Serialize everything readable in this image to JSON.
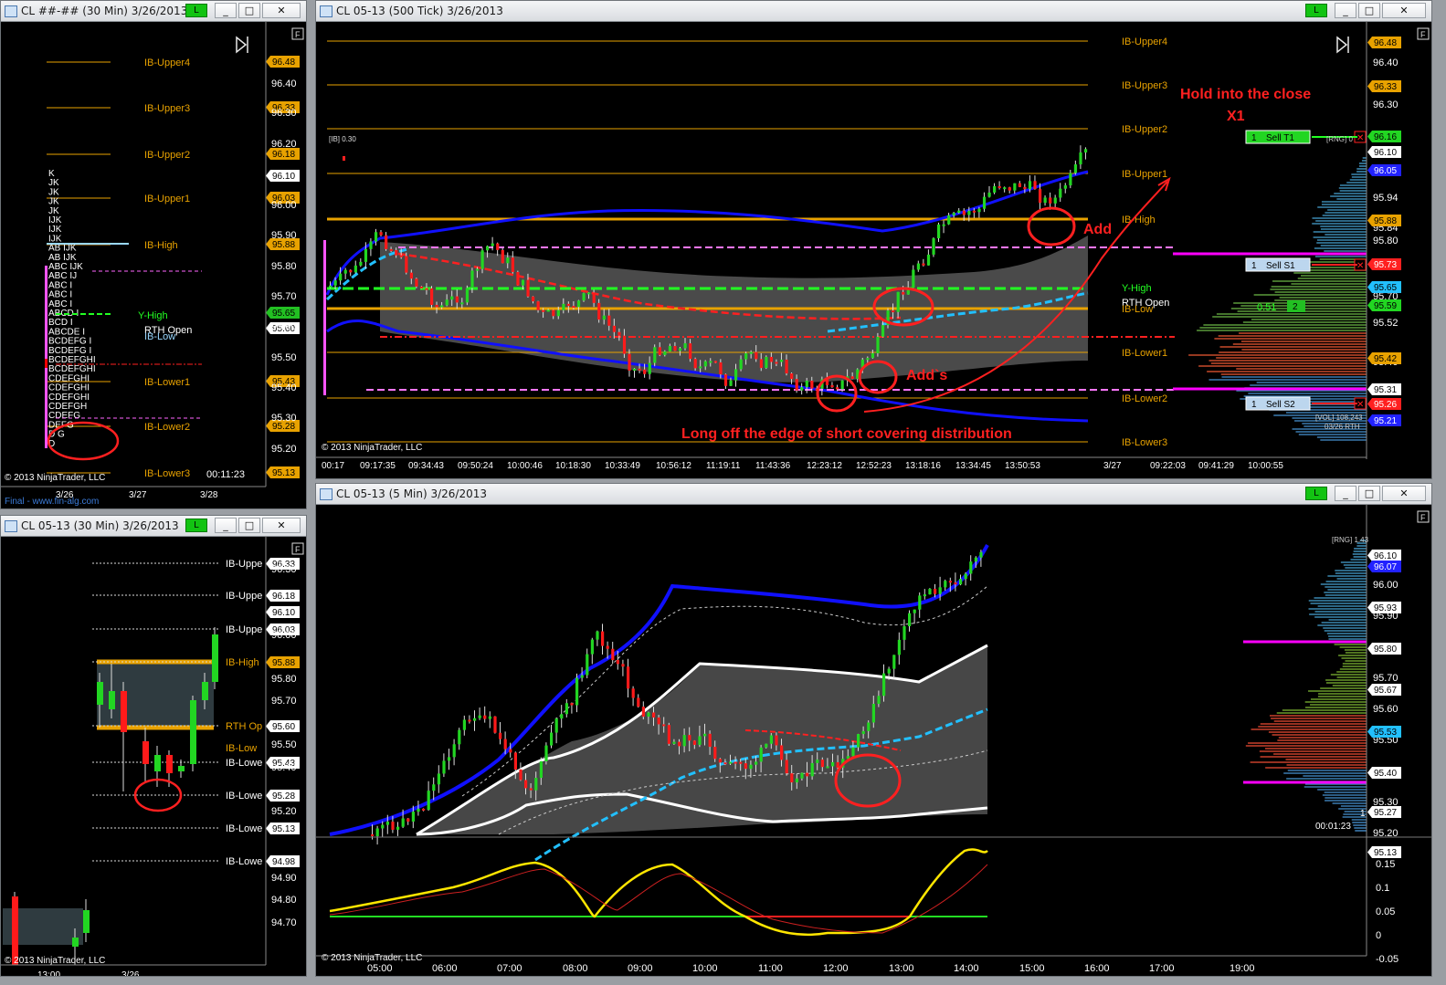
{
  "windows": {
    "tpo": {
      "title": "CL ##-## (30 Min)  3/26/2013",
      "btn_l": "L"
    },
    "tick": {
      "title": "CL 05-13 (500 Tick)  3/26/2013",
      "btn_l": "L"
    },
    "min30": {
      "title": "CL 05-13 (30 Min)  3/26/2013",
      "btn_l": "L"
    },
    "min5": {
      "title": "CL 05-13 (5 Min)  3/26/2013",
      "btn_l": "L"
    }
  },
  "window_buttons": {
    "minimize": "_",
    "maximize": "□",
    "close": "✕"
  },
  "common": {
    "copyright": "© 2013 NinjaTrader, LLC",
    "f_box": "F"
  },
  "colors": {
    "bg": "#000000",
    "up_bar": "#22d622",
    "down_bar": "#ff1a1a",
    "ib_lines": "#e8a200",
    "keltner": "#1010ff",
    "profile": "#2fa0c0",
    "annotation": "#ff2020"
  },
  "tpo": {
    "levels": [
      {
        "name": "IB-Upper4",
        "price": "96.48"
      },
      {
        "name": "IB-Upper3",
        "price": "96.33"
      },
      {
        "name": "IB-Upper2",
        "price": "96.18"
      },
      {
        "name": "IB-Upper1",
        "price": "96.03"
      },
      {
        "name": "IB-High",
        "price": "95.88"
      },
      {
        "name": "IB-Lower1",
        "price": "95.43"
      },
      {
        "name": "IB-Lower2",
        "price": "95.28"
      },
      {
        "name": "IB-Lower3",
        "price": "95.13"
      }
    ],
    "misc_labels": {
      "y_high": "Y-High",
      "y_high_price": "95.65",
      "rth_open": "RTH Open",
      "rth_price": "95.60",
      "ib_low": "IB-Low"
    },
    "axis": [
      "96.40",
      "96.30",
      "96.20",
      "96.10",
      "96.00",
      "95.90",
      "95.80",
      "95.70",
      "95.60",
      "95.50",
      "95.40",
      "95.30",
      "95.20"
    ],
    "tpo_rows": [
      "K",
      "JK",
      "JK",
      "JK",
      "JK",
      "IJK",
      "IJK",
      "IJK",
      "AB      IJK",
      "AB      IJK",
      "ABC     IJK",
      "ABC     IJ",
      "ABC     I",
      "ABC     I",
      "ABC     I",
      "ABCD    I",
      "BCD     I",
      "ABCDE   I",
      "BCDEFG  I",
      "BCDEFG  I",
      "BCDEFGHI",
      "BCDEFGHI",
      "CDEFGHI",
      "CDEFGHI",
      "CDEFGHI",
      "CDEFGH",
      "CDEFG",
      "DEFG",
      "D   G",
      "D"
    ],
    "x_axis": [
      "3/26",
      "3/27",
      "3/28"
    ],
    "timer": "00:11:23",
    "footer": "Final - www.fin-alg.com"
  },
  "tick": {
    "levels": [
      {
        "name": "IB-Upper4"
      },
      {
        "name": "IB-Upper3"
      },
      {
        "name": "IB-Upper2"
      },
      {
        "name": "IB-Upper1"
      },
      {
        "name": "IB-High"
      },
      {
        "name": "Y-High"
      },
      {
        "name": "RTH Open"
      },
      {
        "name": "IB-Low"
      },
      {
        "name": "IB-Lower1"
      },
      {
        "name": "IB-Lower2"
      },
      {
        "name": "IB-Lower3"
      }
    ],
    "price_tags": [
      "96.48",
      "96.33",
      "96.16",
      "96.05",
      "95.88",
      "95.73",
      "95.65",
      "95.59",
      "95.42",
      "95.31",
      "95.26",
      "95.21"
    ],
    "axis": [
      "96.40",
      "96.30",
      "96.10",
      "95.94",
      "95.84",
      "95.80",
      "95.70",
      "95.52",
      "95.40"
    ],
    "ib_label": "[IB] 0.30",
    "orders": [
      {
        "qty": "1",
        "label": "Sell T1"
      },
      {
        "qty": "1",
        "label": "Sell S1"
      },
      {
        "qty": "1",
        "label": "Sell S2"
      }
    ],
    "rng_label": "[RNG] 0",
    "vol_label": "[VOL] 108,243",
    "vol_date": "03/26 RTH",
    "mid_value": "0.51",
    "mid_qty": "2",
    "time_axis": [
      "00:17",
      "09:17:35",
      "09:34:43",
      "09:50:24",
      "10:00:46",
      "10:18:30",
      "10:33:49",
      "10:56:12",
      "11:19:11",
      "11:43:36",
      "12:23:12",
      "12:52:23",
      "13:18:16",
      "13:34:45",
      "13:50:53",
      "3/27",
      "09:22:03",
      "09:41:29",
      "10:00:55"
    ],
    "annotations": {
      "hold": "Hold into the close",
      "x1": "X1",
      "add": "Add",
      "adds": "Add`s",
      "long": "Long off the edge of short covering distribution"
    }
  },
  "min30": {
    "levels": [
      {
        "name": "IB-Uppe",
        "price": "96.33"
      },
      {
        "name": "IB-Uppe",
        "price": "96.18"
      },
      {
        "name": "IB-Uppe",
        "price": "96.03"
      },
      {
        "name": "IB-High",
        "price": "95.88"
      },
      {
        "name": "RTH Op",
        "price": "95.60"
      },
      {
        "name": "IB-Lowe",
        "price": "95.43"
      },
      {
        "name": "IB-Lowe",
        "price": "95.28"
      },
      {
        "name": "IB-Lowe",
        "price": "95.13"
      },
      {
        "name": "IB-Lowe",
        "price": "94.98"
      }
    ],
    "extra_tags": [
      "96.10"
    ],
    "low_label": "IB-Low",
    "axis": [
      "96.30",
      "96.00",
      "95.80",
      "95.70",
      "95.50",
      "95.40",
      "95.20",
      "94.90",
      "94.80",
      "94.70"
    ],
    "x_axis": [
      "13:00",
      "3/26"
    ]
  },
  "min5": {
    "axis": [
      "96.00",
      "95.90",
      "95.70",
      "95.60",
      "95.50",
      "95.30",
      "95.20"
    ],
    "price_tags": [
      "96.10",
      "96.07",
      "95.93",
      "95.80",
      "95.67",
      "95.53",
      "95.40",
      "95.27",
      "95.13"
    ],
    "rng_label": "[RNG] 1.43",
    "timer": "00:01:23",
    "count": "1",
    "osc_axis": [
      "0.15",
      "0.1",
      "0.05",
      "0",
      "-0.05"
    ],
    "time_axis": [
      "05:00",
      "06:00",
      "07:00",
      "08:00",
      "09:00",
      "10:00",
      "11:00",
      "12:00",
      "13:00",
      "14:00",
      "15:00",
      "16:00",
      "17:00",
      "19:00"
    ]
  }
}
